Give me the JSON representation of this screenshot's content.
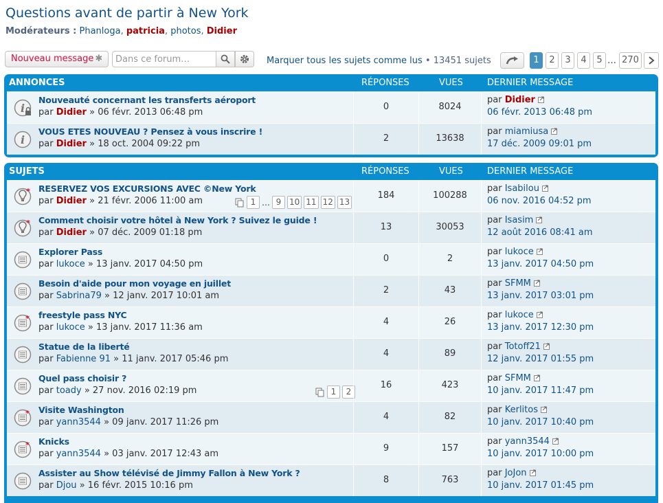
{
  "forum": {
    "title": "Questions avant de partir à New York",
    "moderators_label": "Modérateurs :",
    "moderators": [
      {
        "name": "Phanloga",
        "red": false
      },
      {
        "name": "patricia",
        "red": true
      },
      {
        "name": "photos",
        "red": false
      },
      {
        "name": "Didier",
        "red": true
      }
    ]
  },
  "toolbar": {
    "new_post_label": "Nouveau message",
    "search_placeholder": "Dans ce forum…",
    "mark_read": "Marquer tous les sujets comme lus",
    "sep": "•",
    "topic_count": "13451 sujets"
  },
  "pagination": {
    "pages": [
      "1",
      "2",
      "3",
      "4",
      "5"
    ],
    "current": "1",
    "dots": "…",
    "last": "270"
  },
  "announcements": {
    "header": {
      "title": "ANNONCES",
      "replies": "RÉPONSES",
      "views": "VUES",
      "last": "DERNIER MESSAGE"
    },
    "rows": [
      {
        "title": "Nouveauté concernant les transferts aéroport",
        "by": "par",
        "author": "Didier",
        "author_red": true,
        "date": "» 06 févr. 2013 06:48 pm",
        "replies": "0",
        "views": "8024",
        "last_by": "par",
        "last_author": "Didier",
        "last_red": true,
        "last_date": "06 févr. 2013 06:48 pm",
        "locked": true
      },
      {
        "title": "VOUS ETES NOUVEAU ? Pensez à vous inscrire !",
        "by": "par",
        "author": "Didier",
        "author_red": true,
        "date": "» 18 oct. 2004 09:22 pm",
        "replies": "2",
        "views": "13638",
        "last_by": "par",
        "last_author": "miamiusa",
        "last_red": false,
        "last_date": "17 déc. 2009 09:01 pm",
        "locked": false
      }
    ]
  },
  "topics": {
    "header": {
      "title": "SUJETS",
      "replies": "RÉPONSES",
      "views": "VUES",
      "last": "DERNIER MESSAGE"
    },
    "rows": [
      {
        "title": "RESERVEZ VOS EXCURSIONS AVEC ©New York",
        "by": "par",
        "author": "Didier",
        "author_red": true,
        "date": "» 21 févr. 2006 11:00 am",
        "replies": "184",
        "views": "100288",
        "last_by": "par",
        "last_author": "Isabilou",
        "last_date": "06 nov. 2016 04:52 pm",
        "icon": "sticky",
        "pages": [
          "1",
          "…",
          "9",
          "10",
          "11",
          "12",
          "13"
        ]
      },
      {
        "title": "Comment choisir votre hôtel à New York ? Suivez le guide !",
        "by": "par",
        "author": "Didier",
        "author_red": true,
        "date": "» 07 déc. 2009 01:18 pm",
        "replies": "13",
        "views": "30053",
        "last_by": "par",
        "last_author": "Isasim",
        "last_date": "12 août 2016 08:41 am",
        "icon": "sticky"
      },
      {
        "title": "Explorer Pass",
        "by": "par",
        "author": "lukoce",
        "author_red": false,
        "date": "» 13 janv. 2017 04:50 pm",
        "replies": "0",
        "views": "2",
        "last_by": "par",
        "last_author": "lukoce",
        "last_date": "13 janv. 2017 04:50 pm",
        "icon": "read"
      },
      {
        "title": "Besoin d'aide pour mon voyage en juillet",
        "by": "par",
        "author": "Sabrina79",
        "author_red": false,
        "date": "» 12 janv. 2017 10:01 am",
        "replies": "2",
        "views": "43",
        "last_by": "par",
        "last_author": "SFMM",
        "last_date": "13 janv. 2017 03:01 pm",
        "icon": "read"
      },
      {
        "title": "freestyle pass NYC",
        "by": "par",
        "author": "lukoce",
        "author_red": false,
        "date": "» 13 janv. 2017 11:36 am",
        "replies": "4",
        "views": "26",
        "last_by": "par",
        "last_author": "lukoce",
        "last_date": "13 janv. 2017 12:30 pm",
        "icon": "mine"
      },
      {
        "title": "Statue de la liberté",
        "by": "par",
        "author": "Fabienne 91",
        "author_red": false,
        "date": "» 11 janv. 2017 05:46 pm",
        "replies": "4",
        "views": "89",
        "last_by": "par",
        "last_author": "Totoff21",
        "last_date": "12 janv. 2017 01:55 pm",
        "icon": "read"
      },
      {
        "title": "Quel pass choisir ?",
        "by": "par",
        "author": "toady",
        "author_red": false,
        "date": "» 27 nov. 2016 02:19 pm",
        "replies": "16",
        "views": "423",
        "last_by": "par",
        "last_author": "SFMM",
        "last_date": "10 janv. 2017 11:47 pm",
        "icon": "read",
        "pages": [
          "1",
          "2"
        ]
      },
      {
        "title": "Visite Washington",
        "by": "par",
        "author": "yann3544",
        "author_red": false,
        "date": "» 09 janv. 2017 11:26 pm",
        "replies": "4",
        "views": "82",
        "last_by": "par",
        "last_author": "Kerlitos",
        "last_date": "10 janv. 2017 10:40 pm",
        "icon": "mine"
      },
      {
        "title": "Knicks",
        "by": "par",
        "author": "yann3544",
        "author_red": false,
        "date": "» 03 janv. 2017 12:43 am",
        "replies": "9",
        "views": "157",
        "last_by": "par",
        "last_author": "yann3544",
        "last_date": "10 janv. 2017 10:00 pm",
        "icon": "mine"
      },
      {
        "title": "Assister au Show télévisé de Jimmy Fallon à New York ?",
        "by": "par",
        "author": "Djou",
        "author_red": false,
        "date": "» 16 févr. 2015 10:16 pm",
        "replies": "8",
        "views": "763",
        "last_by": "par",
        "last_author": "JoJon",
        "last_date": "10 janv. 2017 01:45 pm",
        "icon": "read"
      }
    ]
  },
  "colors": {
    "accent": "#0a8ed0",
    "link": "#105289",
    "red": "#aa0000",
    "row_a": "#eef5f9",
    "row_b": "#e1ebf2"
  },
  "icons": {
    "new_post": "asterisk-icon",
    "search": "search-icon",
    "advanced": "gear-icon",
    "jump": "jump-arrow-icon",
    "next": "chevron-right-icon",
    "view_latest": "view-latest-icon",
    "multipage": "pages-icon"
  }
}
